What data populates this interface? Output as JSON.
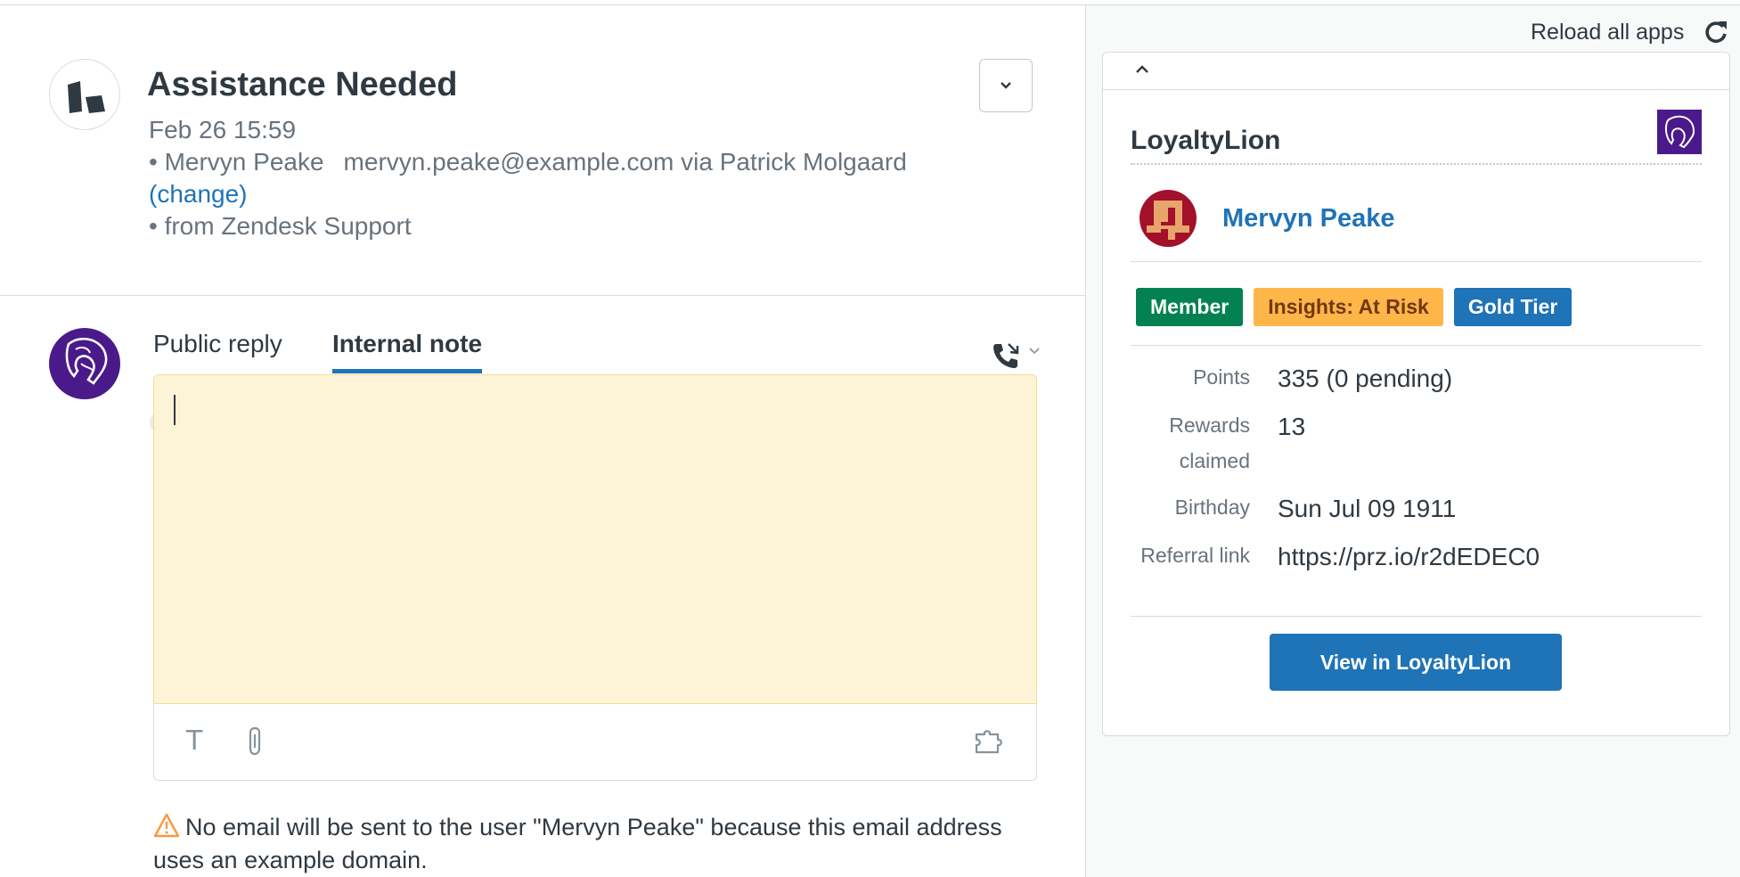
{
  "ticket": {
    "title": "Assistance Needed",
    "date": "Feb 26 15:59",
    "requester_line_name": "• Mervyn Peake",
    "requester_line_rest": "mervyn.peake@example.com via Patrick Molgaard",
    "change_link": "(change)",
    "source": "• from Zendesk Support"
  },
  "composer": {
    "tabs": [
      {
        "label": "Public reply",
        "active": false
      },
      {
        "label": "Internal note",
        "active": true
      }
    ],
    "toolbar": {
      "text_format_glyph": "T"
    },
    "warning": "No email will be sent to the user \"Mervyn Peake\" because this email address uses an example domain."
  },
  "apps_panel": {
    "reload_label": "Reload all apps",
    "app": {
      "name": "LoyaltyLion",
      "customer_name": "Mervyn Peake",
      "tags": [
        {
          "label": "Member",
          "color": "#038153"
        },
        {
          "label": "Insights: At Risk",
          "color": "#ffb648"
        },
        {
          "label": "Gold Tier",
          "color": "#1f73b7"
        }
      ],
      "fields": [
        {
          "label": "Points",
          "value": "335 (0 pending)"
        },
        {
          "label": "Rewards claimed",
          "value": "13"
        },
        {
          "label": "Birthday",
          "value": "Sun Jul 09 1911"
        },
        {
          "label": "Referral link",
          "value": "https://prz.io/r2dEDEC0"
        }
      ],
      "view_button": "View in LoyaltyLion"
    }
  },
  "colors": {
    "accent": "#1f73b7",
    "note_background": "#fdf3d7",
    "brand_purple": "#4a1a8a"
  }
}
